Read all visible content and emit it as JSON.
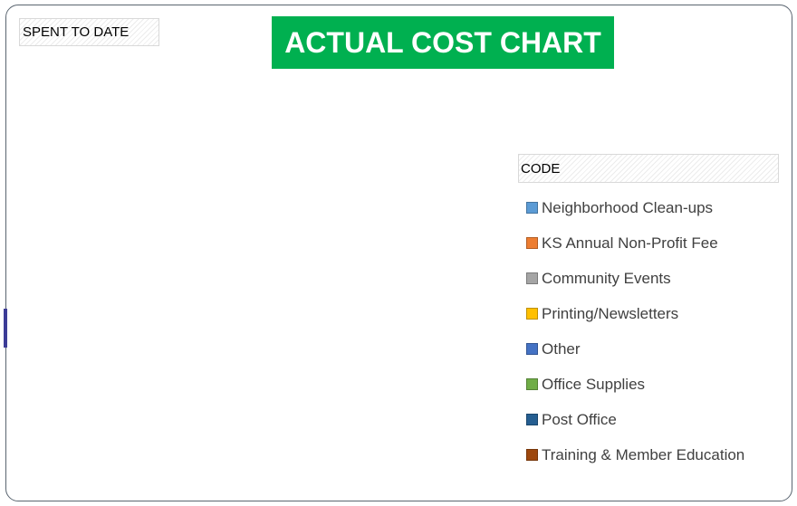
{
  "chart_data": {
    "type": "pie",
    "title": "ACTUAL COST CHART",
    "value_field": "SPENT TO DATE",
    "legend_title": "CODE",
    "legend_position": "right",
    "categories": [
      "Neighborhood Clean-ups",
      "KS Annual Non-Profit Fee",
      "Community Events",
      "Printing/Newsletters",
      "Other",
      "Office Supplies",
      "Post Office",
      "Training & Member Education"
    ],
    "colors": [
      "#5b9bd5",
      "#ed7d31",
      "#a5a5a5",
      "#ffc000",
      "#4472c4",
      "#70ad47",
      "#255e91",
      "#9e480e"
    ],
    "values": [],
    "title_background": "#00b050"
  }
}
